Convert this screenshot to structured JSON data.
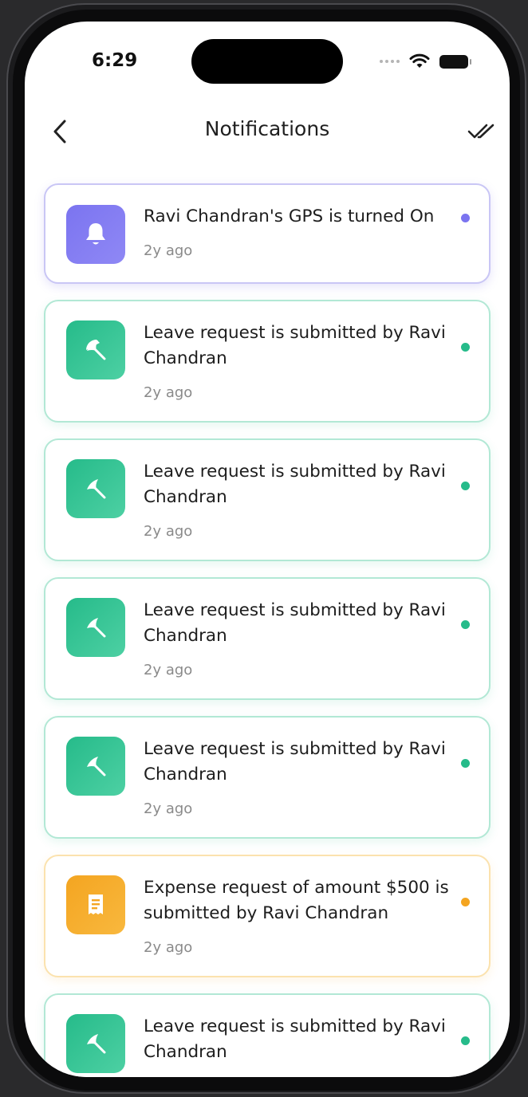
{
  "status_bar": {
    "time": "6:29"
  },
  "header": {
    "title": "Notifications"
  },
  "colors": {
    "purple": "#7B74F0",
    "green": "#26BB8A",
    "orange": "#F4A521"
  },
  "notifications": [
    {
      "type": "gps",
      "icon": "bell-icon",
      "message": "Ravi Chandran's GPS is turned On",
      "ago": "2y ago",
      "color": "purple"
    },
    {
      "type": "leave",
      "icon": "umbrella-icon",
      "message": "Leave request is submitted by Ravi Chandran",
      "ago": "2y ago",
      "color": "green"
    },
    {
      "type": "leave",
      "icon": "umbrella-icon",
      "message": "Leave request is submitted by Ravi Chandran",
      "ago": "2y ago",
      "color": "green"
    },
    {
      "type": "leave",
      "icon": "umbrella-icon",
      "message": "Leave request is submitted by Ravi Chandran",
      "ago": "2y ago",
      "color": "green"
    },
    {
      "type": "leave",
      "icon": "umbrella-icon",
      "message": "Leave request is submitted by Ravi Chandran",
      "ago": "2y ago",
      "color": "green"
    },
    {
      "type": "expense",
      "icon": "receipt-icon",
      "message": "Expense request of amount $500 is submitted by Ravi Chandran",
      "ago": "2y ago",
      "color": "orange"
    },
    {
      "type": "leave",
      "icon": "umbrella-icon",
      "message": "Leave request is submitted by Ravi Chandran",
      "ago": "",
      "color": "green"
    }
  ]
}
